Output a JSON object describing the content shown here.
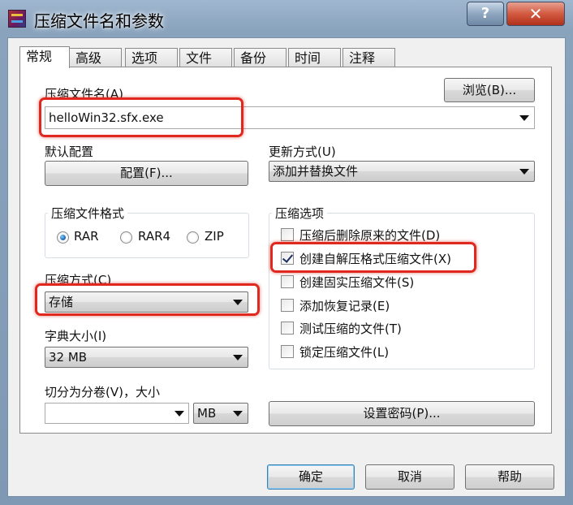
{
  "window": {
    "title": "压缩文件名和参数",
    "help_label": "?",
    "close_label": "✕"
  },
  "tabs": [
    {
      "label": "常规",
      "active": true
    },
    {
      "label": "高级"
    },
    {
      "label": "选项"
    },
    {
      "label": "文件"
    },
    {
      "label": "备份"
    },
    {
      "label": "时间"
    },
    {
      "label": "注释"
    }
  ],
  "general": {
    "archive_name_label": "压缩文件名(A)",
    "archive_name_value": "helloWin32.sfx.exe",
    "browse_label": "浏览(B)...",
    "default_profile_label": "默认配置",
    "profile_button_label": "配置(F)...",
    "update_mode_label": "更新方式(U)",
    "update_mode_value": "添加并替换文件",
    "format_group_title": "压缩文件格式",
    "formats": [
      {
        "label": "RAR",
        "selected": true
      },
      {
        "label": "RAR4",
        "selected": false
      },
      {
        "label": "ZIP",
        "selected": false
      }
    ],
    "method_label": "压缩方式(C)",
    "method_value": "存储",
    "dict_label": "字典大小(I)",
    "dict_value": "32 MB",
    "split_label": "切分为分卷(V)，大小",
    "split_value": "",
    "split_unit": "MB",
    "options_group_title": "压缩选项",
    "options": [
      {
        "label": "压缩后删除原来的文件(D)",
        "checked": false
      },
      {
        "label": "创建自解压格式压缩文件(X)",
        "checked": true
      },
      {
        "label": "创建固实压缩文件(S)",
        "checked": false
      },
      {
        "label": "添加恢复记录(E)",
        "checked": false
      },
      {
        "label": "测试压缩的文件(T)",
        "checked": false
      },
      {
        "label": "锁定压缩文件(L)",
        "checked": false
      }
    ],
    "password_button_label": "设置密码(P)..."
  },
  "footer": {
    "ok_label": "确定",
    "cancel_label": "取消",
    "help_label": "帮助"
  },
  "colors": {
    "highlight": "#e0281e",
    "titlebar": "#8aa3bd"
  }
}
